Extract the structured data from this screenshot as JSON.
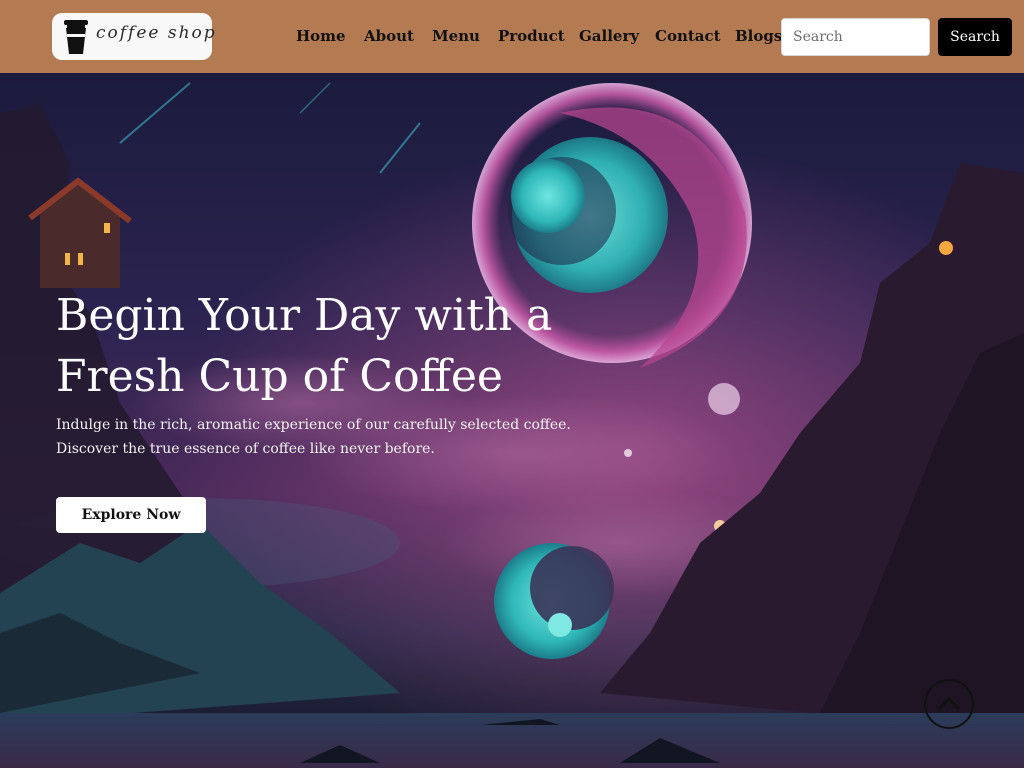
{
  "logo": {
    "text": "coffee shop",
    "icon": "coffee-cup-icon"
  },
  "nav": {
    "items": [
      {
        "label": "Home"
      },
      {
        "label": "About"
      },
      {
        "label": "Menu"
      },
      {
        "label": "Product"
      },
      {
        "label": "Gallery"
      },
      {
        "label": "Contact"
      },
      {
        "label": "Blogs"
      }
    ]
  },
  "search": {
    "placeholder": "Search",
    "value": "",
    "button_label": "Search"
  },
  "hero": {
    "title_line1": "Begin Your Day with a",
    "title_line2": "Fresh Cup of Coffee",
    "subtitle_line1": "Indulge in the rich, aromatic experience of our carefully selected coffee.",
    "subtitle_line2": "Discover the true essence of coffee like never before.",
    "cta_label": "Explore Now",
    "scroll_icon": "chevron-up-icon"
  },
  "colors": {
    "navbar": "#b47a52",
    "cta_bg": "#ffffff",
    "search_button_bg": "#000000"
  }
}
